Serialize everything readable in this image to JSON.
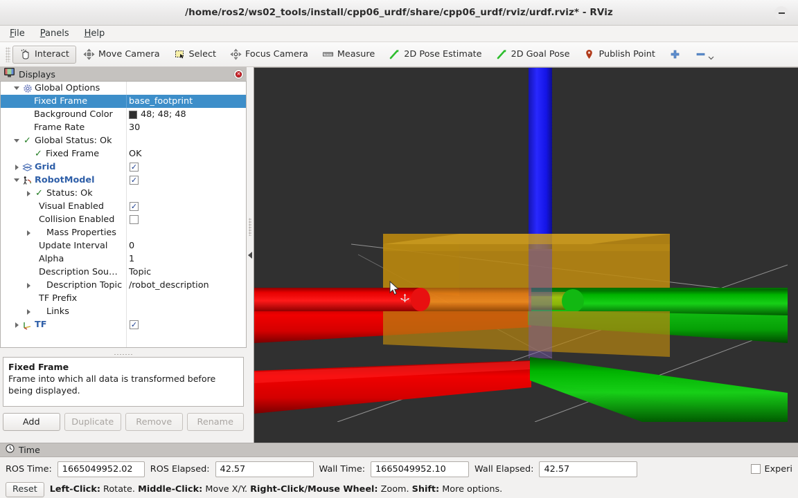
{
  "window": {
    "title": "/home/ros2/ws02_tools/install/cpp06_urdf/share/cpp06_urdf/rviz/urdf.rviz* - RViz",
    "minimize_label": "−"
  },
  "menu": {
    "items": [
      {
        "label": "File",
        "mnemonic": "F"
      },
      {
        "label": "Panels",
        "mnemonic": "P"
      },
      {
        "label": "Help",
        "mnemonic": "H"
      }
    ]
  },
  "toolbar": {
    "buttons": [
      {
        "label": "Interact",
        "icon": "hand-icon",
        "active": true
      },
      {
        "label": "Move Camera",
        "icon": "move-camera-icon",
        "active": false
      },
      {
        "label": "Select",
        "icon": "select-rect-icon",
        "active": false
      },
      {
        "label": "Focus Camera",
        "icon": "focus-camera-icon",
        "active": false
      },
      {
        "label": "Measure",
        "icon": "ruler-icon",
        "active": false
      },
      {
        "label": "2D Pose Estimate",
        "icon": "pose-arrow-icon",
        "active": false
      },
      {
        "label": "2D Goal Pose",
        "icon": "goal-arrow-icon",
        "active": false
      },
      {
        "label": "Publish Point",
        "icon": "map-pin-icon",
        "active": false
      }
    ],
    "add_tool_icon": "plus-icon",
    "remove_tool_icon": "minus-icon",
    "overflow_icon": "chevron-down-icon"
  },
  "displays_panel": {
    "title": "Displays",
    "close_icon": "close-icon",
    "rows": [
      {
        "indent": 0,
        "expander": "down",
        "icon": "gear-icon",
        "name": "Global Options",
        "value": "",
        "value_type": "none",
        "bold": false,
        "selected": false
      },
      {
        "indent": 1,
        "expander": "none",
        "icon": "none",
        "name": "Fixed Frame",
        "value": "base_footprint",
        "value_type": "text",
        "bold": false,
        "selected": true
      },
      {
        "indent": 1,
        "expander": "none",
        "icon": "none",
        "name": "Background Color",
        "value": "48; 48; 48",
        "value_type": "color",
        "bold": false,
        "selected": false,
        "swatch": "#303030"
      },
      {
        "indent": 1,
        "expander": "none",
        "icon": "none",
        "name": "Frame Rate",
        "value": "30",
        "value_type": "text",
        "bold": false,
        "selected": false
      },
      {
        "indent": 0,
        "expander": "down",
        "icon": "check-icon",
        "name": "Global Status: Ok",
        "value": "",
        "value_type": "none",
        "bold": false,
        "selected": false
      },
      {
        "indent": 1,
        "expander": "none",
        "icon": "check-icon",
        "name": "Fixed Frame",
        "value": "OK",
        "value_type": "text",
        "bold": false,
        "selected": false
      },
      {
        "indent": 0,
        "expander": "right",
        "icon": "grid-icon",
        "name": "Grid",
        "value": "checked",
        "value_type": "checkbox",
        "bold": true,
        "selected": false
      },
      {
        "indent": 0,
        "expander": "down",
        "icon": "robot-icon",
        "name": "RobotModel",
        "value": "checked",
        "value_type": "checkbox",
        "bold": true,
        "selected": false
      },
      {
        "indent": 1,
        "expander": "right",
        "icon": "check-icon",
        "name": "Status: Ok",
        "value": "",
        "value_type": "none",
        "bold": false,
        "selected": false
      },
      {
        "indent": 1,
        "expander": "none",
        "icon": "none",
        "name": "Visual Enabled",
        "value": "checked",
        "value_type": "checkbox",
        "bold": false,
        "selected": false
      },
      {
        "indent": 1,
        "expander": "none",
        "icon": "none",
        "name": "Collision Enabled",
        "value": "unchecked",
        "value_type": "checkbox",
        "bold": false,
        "selected": false
      },
      {
        "indent": 1,
        "expander": "right",
        "icon": "none",
        "name": "Mass Properties",
        "value": "",
        "value_type": "none",
        "bold": false,
        "selected": false
      },
      {
        "indent": 1,
        "expander": "none",
        "icon": "none",
        "name": "Update Interval",
        "value": "0",
        "value_type": "text",
        "bold": false,
        "selected": false
      },
      {
        "indent": 1,
        "expander": "none",
        "icon": "none",
        "name": "Alpha",
        "value": "1",
        "value_type": "text",
        "bold": false,
        "selected": false
      },
      {
        "indent": 1,
        "expander": "none",
        "icon": "none",
        "name": "Description Sou…",
        "value": "Topic",
        "value_type": "text",
        "bold": false,
        "selected": false
      },
      {
        "indent": 1,
        "expander": "right",
        "icon": "none",
        "name": "Description Topic",
        "value": "/robot_description",
        "value_type": "text",
        "bold": false,
        "selected": false
      },
      {
        "indent": 1,
        "expander": "none",
        "icon": "none",
        "name": "TF Prefix",
        "value": "",
        "value_type": "text",
        "bold": false,
        "selected": false
      },
      {
        "indent": 1,
        "expander": "right",
        "icon": "none",
        "name": "Links",
        "value": "",
        "value_type": "none",
        "bold": false,
        "selected": false
      },
      {
        "indent": 0,
        "expander": "right",
        "icon": "tf-axes-icon",
        "name": "TF",
        "value": "checked",
        "value_type": "checkbox",
        "bold": true,
        "selected": false
      }
    ],
    "help": {
      "title": "Fixed Frame",
      "body": "Frame into which all data is transformed before being displayed."
    },
    "buttons": [
      {
        "label": "Add",
        "enabled": true
      },
      {
        "label": "Duplicate",
        "enabled": false
      },
      {
        "label": "Remove",
        "enabled": false
      },
      {
        "label": "Rename",
        "enabled": false
      }
    ],
    "collapse_icon": "collapse-left-arrow-icon"
  },
  "viewport": {
    "background_color": "#303030",
    "cursor_icon": "arrow-cursor",
    "move_cursor_icon": "move-axes-icon",
    "scene": {
      "grid_line_color": "#bfbfbf",
      "base_link_box_color": "#c09018",
      "x_axis_color": "#e00000",
      "y_axis_color": "#00c000",
      "z_axis_color": "#1818e8"
    }
  },
  "time_panel": {
    "title": "Time",
    "clock_icon": "clock-icon",
    "fields": [
      {
        "label": "ROS Time:",
        "value": "1665049952.02"
      },
      {
        "label": "ROS Elapsed:",
        "value": "42.57"
      },
      {
        "label": "Wall Time:",
        "value": "1665049952.10"
      },
      {
        "label": "Wall Elapsed:",
        "value": "42.57"
      }
    ],
    "experimental": {
      "label": "Experi",
      "checked": false
    },
    "reset_label": "Reset",
    "hint_parts": [
      {
        "text": "Left-Click:",
        "bold": true
      },
      {
        "text": " Rotate. ",
        "bold": false
      },
      {
        "text": "Middle-Click:",
        "bold": true
      },
      {
        "text": " Move X/Y. ",
        "bold": false
      },
      {
        "text": "Right-Click/Mouse Wheel:",
        "bold": true
      },
      {
        "text": " Zoom. ",
        "bold": false
      },
      {
        "text": "Shift:",
        "bold": true
      },
      {
        "text": " More options.",
        "bold": false
      }
    ]
  }
}
